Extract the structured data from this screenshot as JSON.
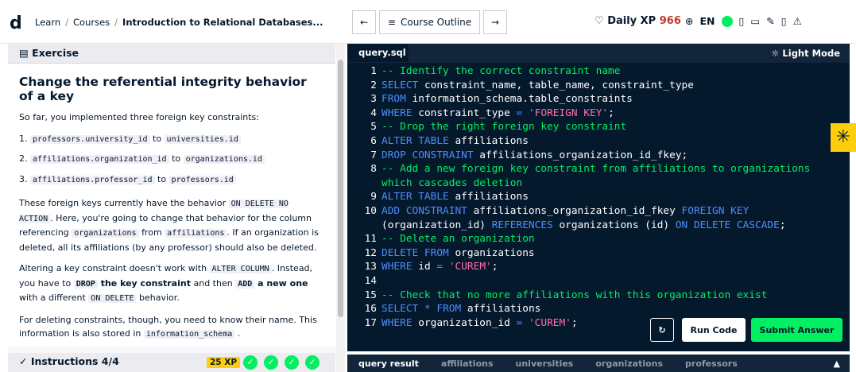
{
  "topbar": {
    "breadcrumb": [
      "Learn",
      "Courses",
      "Introduction to Relational Databases..."
    ],
    "course_outline": "Course Outline",
    "prev_arrow": "←",
    "next_arrow": "→",
    "xp_label": "Daily XP",
    "xp_value": "966",
    "lang": "EN"
  },
  "left": {
    "exercise_label": "Exercise",
    "title": "Change the referential integrity behavior of a key",
    "intro": "So far, you implemented three foreign key constraints:",
    "list": [
      {
        "n": "1.",
        "a": "professors.university_id",
        "to": "to",
        "b": "universities.id"
      },
      {
        "n": "2.",
        "a": "affiliations.organization_id",
        "to": "to",
        "b": "organizations.id"
      },
      {
        "n": "3.",
        "a": "affiliations.professor_id",
        "to": "to",
        "b": "professors.id"
      }
    ],
    "p1_a": "These foreign keys currently have the behavior",
    "p1_code1": "ON DELETE NO ACTION",
    "p1_b": ". Here, you're going to change that behavior for the column referencing",
    "p1_code2": "organizations",
    "p1_c": "from",
    "p1_code3": "affiliations",
    "p1_d": ". If an organization is deleted, all its affiliations (by any professor) should also be deleted.",
    "p2_a": "Altering a key constraint doesn't work with",
    "p2_code1": "ALTER COLUMN",
    "p2_b": ". Instead, you have to",
    "p2_code2": "DROP",
    "p2_c": "the key constraint",
    "p2_d": "and then",
    "p2_code3": "ADD",
    "p2_e": "a new one",
    "p2_f": "with a different",
    "p2_code4": "ON DELETE",
    "p2_g": "behavior.",
    "p3_a": "For deleting constraints, though, you need to know their name. This information is also stored in",
    "p3_code": "information_schema",
    "p3_b": ".",
    "instructions": "Instructions 4/4",
    "xp_badge": "25 XP"
  },
  "editor": {
    "tab": "query.sql",
    "light_mode": "Light Mode",
    "run": "Run Code",
    "submit": "Submit Answer",
    "lines": [
      {
        "n": "1",
        "html": "<span class='cm'>-- Identify the correct constraint name</span>"
      },
      {
        "n": "2",
        "html": "<span class='kw'>SELECT</span> constraint_name, table_name, constraint_type"
      },
      {
        "n": "3",
        "html": "<span class='kw'>FROM</span> information_schema.table_constraints"
      },
      {
        "n": "4",
        "html": "<span class='kw'>WHERE</span> constraint_type <span class='op'>=</span> <span class='str'>'FOREIGN KEY'</span>;"
      },
      {
        "n": "5",
        "html": "<span class='cm'>-- Drop the right foreign key constraint</span>"
      },
      {
        "n": "6",
        "html": "<span class='kw'>ALTER TABLE</span> affiliations"
      },
      {
        "n": "7",
        "html": "<span class='kw'>DROP CONSTRAINT</span> affiliations_organization_id_fkey;"
      },
      {
        "n": "8",
        "html": "<span class='cm'>-- Add a new foreign key constraint from affiliations to organizations which cascades deletion</span>"
      },
      {
        "n": "9",
        "html": "<span class='kw'>ALTER TABLE</span> affiliations"
      },
      {
        "n": "10",
        "html": "<span class='kw'>ADD CONSTRAINT</span> affiliations_organization_id_fkey <span class='kw'>FOREIGN KEY</span> (organization_id) <span class='kw'>REFERENCES</span> organizations (id) <span class='kw'>ON DELETE CASCADE</span>;"
      },
      {
        "n": "11",
        "html": "<span class='cm'>-- Delete an organization</span>"
      },
      {
        "n": "12",
        "html": "<span class='kw'>DELETE FROM</span> organizations"
      },
      {
        "n": "13",
        "html": "<span class='kw'>WHERE</span> id <span class='op'>=</span> <span class='str'>'CUREM'</span>;"
      },
      {
        "n": "14",
        "html": ""
      },
      {
        "n": "15",
        "html": "<span class='cm'>-- Check that no more affiliations with this organization exist</span>"
      },
      {
        "n": "16",
        "html": "<span class='kw'>SELECT</span> <span class='op'>*</span> <span class='kw'>FROM</span> affiliations"
      },
      {
        "n": "17",
        "html": "<span class='kw'>WHERE</span> organization_id <span class='op'>=</span> <span class='str'>'CUREM'</span>;"
      }
    ]
  },
  "results": {
    "tabs": [
      "query result",
      "affiliations",
      "universities",
      "organizations",
      "professors"
    ]
  },
  "colors": {
    "bg_dark": "#05192d",
    "accent_green": "#03ef62",
    "xp_yellow": "#fcce0d",
    "keyword": "#4c8cff",
    "string": "#ff6ea9"
  }
}
